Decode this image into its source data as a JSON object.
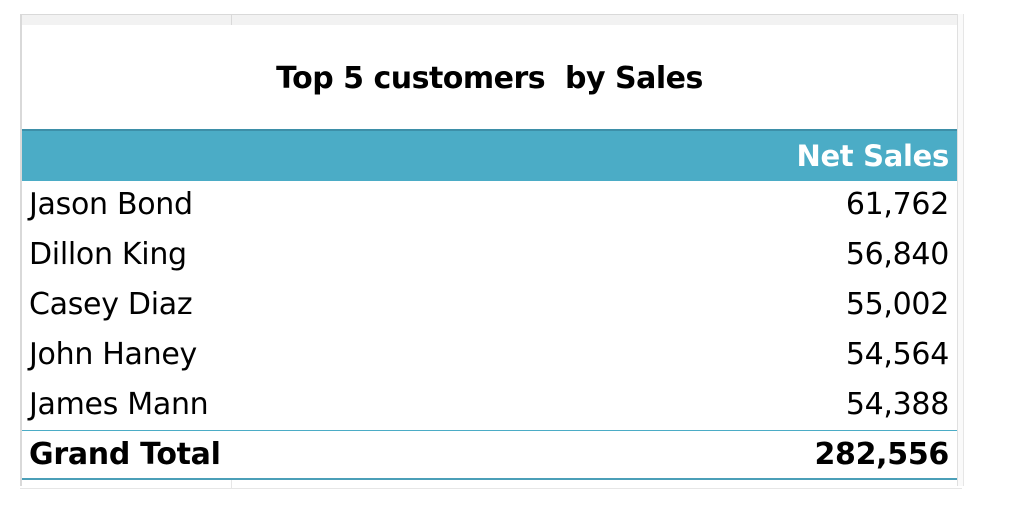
{
  "report": {
    "title": "Top 5 customers  by Sales",
    "column_header": "Net Sales",
    "rows": [
      {
        "customer": "Jason Bond",
        "net_sales": "61,762"
      },
      {
        "customer": "Dillon King",
        "net_sales": "56,840"
      },
      {
        "customer": "Casey Diaz",
        "net_sales": "55,002"
      },
      {
        "customer": "John Haney",
        "net_sales": "54,564"
      },
      {
        "customer": "James Mann",
        "net_sales": "54,388"
      }
    ],
    "total": {
      "label": "Grand Total",
      "value": "282,556"
    }
  },
  "colors": {
    "header_fill": "#4bacc6",
    "header_text": "#ffffff",
    "border_accent": "#4b9fb8"
  }
}
